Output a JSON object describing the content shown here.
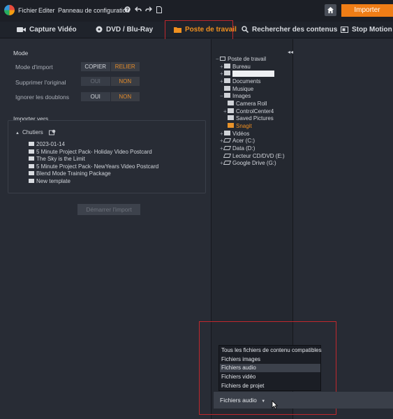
{
  "menu": {
    "file": "Fichier",
    "edit": "Editer",
    "control_panel": "Panneau de configuration",
    "help_icon": "help-icon",
    "undo_icon": "undo-icon",
    "redo_icon": "redo-icon",
    "doc_icon": "document-icon",
    "import_button": "Importer",
    "accent": "#ef7d16"
  },
  "tabs": [
    {
      "label": "Capture Vidéo",
      "icon": "camera-icon"
    },
    {
      "label": "DVD / Blu-Ray",
      "icon": "disc-icon"
    },
    {
      "label": "Poste de travail",
      "icon": "folder-icon",
      "active": true
    },
    {
      "label": "Rechercher des contenus",
      "icon": "search-icon"
    },
    {
      "label": "Stop Motion",
      "icon": "stop-motion-icon"
    }
  ],
  "mode": {
    "title": "Mode",
    "rows": [
      {
        "label": "Mode d'import",
        "options": [
          "COPIER",
          "RELIER"
        ],
        "selected": "RELIER"
      },
      {
        "label": "Supprimer l'original",
        "options": [
          "OUI",
          "NON"
        ],
        "selected": "NON"
      },
      {
        "label": "Ignorer les doublons",
        "options": [
          "OUI",
          "NON"
        ],
        "selected": "NON"
      }
    ]
  },
  "import_to": {
    "title": "Importer vers",
    "root": "Chutiers",
    "items": [
      "2023-01-14",
      "5 Minute Project Pack- Holiday Video Postcard",
      "The Sky is the Limit",
      "5 Minute Project Pack- NewYears Video Postcard",
      "Blend Mode Training Package",
      "New template"
    ]
  },
  "start_import": "Démarrer l'import",
  "tree": {
    "root": "Poste de travail",
    "nodes": [
      {
        "label": "Bureau"
      },
      {
        "label": ""
      },
      {
        "label": "Documents"
      },
      {
        "label": "Musique"
      },
      {
        "label": "Images"
      },
      {
        "label": "Camera Roll"
      },
      {
        "label": "ControlCenter4"
      },
      {
        "label": "Saved Pictures"
      },
      {
        "label": "Snagit",
        "selected": true
      },
      {
        "label": "Vidéos"
      },
      {
        "label": "Acer (C:)"
      },
      {
        "label": "Data (D:)"
      },
      {
        "label": "Lecteur CD/DVD (E:)"
      },
      {
        "label": "Google Drive (G:)"
      }
    ]
  },
  "filter": {
    "options": [
      "Tous les fichiers de contenu compatibles",
      "Fichiers images",
      "Fichiers audio",
      "Fichiers vidéo",
      "Fichiers de projet"
    ],
    "selected": "Fichiers audio",
    "current_label": "Fichiers audio"
  }
}
